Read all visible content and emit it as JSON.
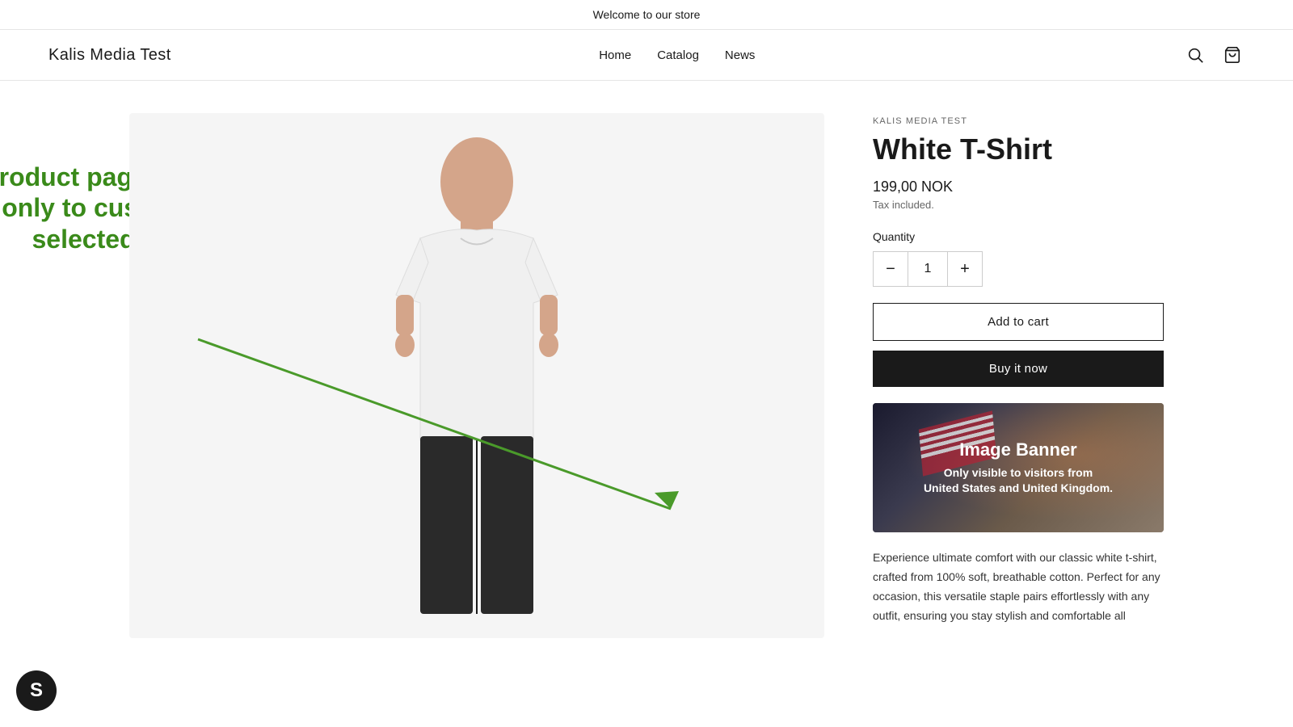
{
  "announcement": {
    "text": "Welcome to our store"
  },
  "header": {
    "logo": "Kalis Media Test",
    "nav": [
      {
        "label": "Home",
        "href": "#"
      },
      {
        "label": "Catalog",
        "href": "#"
      },
      {
        "label": "News",
        "href": "#"
      }
    ],
    "search_label": "Search",
    "cart_label": "Cart"
  },
  "product": {
    "vendor": "KALIS MEDIA TEST",
    "title": "White T-Shirt",
    "price": "199,00 NOK",
    "tax_note": "Tax included.",
    "quantity_label": "Quantity",
    "quantity_value": "1",
    "add_to_cart": "Add to cart",
    "buy_now": "Buy it now",
    "description": "Experience ultimate comfort with our classic white t-shirt, crafted from 100% soft, breathable cotton. Perfect for any occasion, this versatile staple pairs effortlessly with any outfit, ensuring you stay stylish and comfortable all"
  },
  "overlay": {
    "text": "Product page block visible only to customers from selected countries"
  },
  "banner": {
    "title": "Image Banner",
    "subtitle": "Only visible to visitors from\nUnited States and United Kingdom."
  },
  "shopify": {
    "icon": "S"
  }
}
